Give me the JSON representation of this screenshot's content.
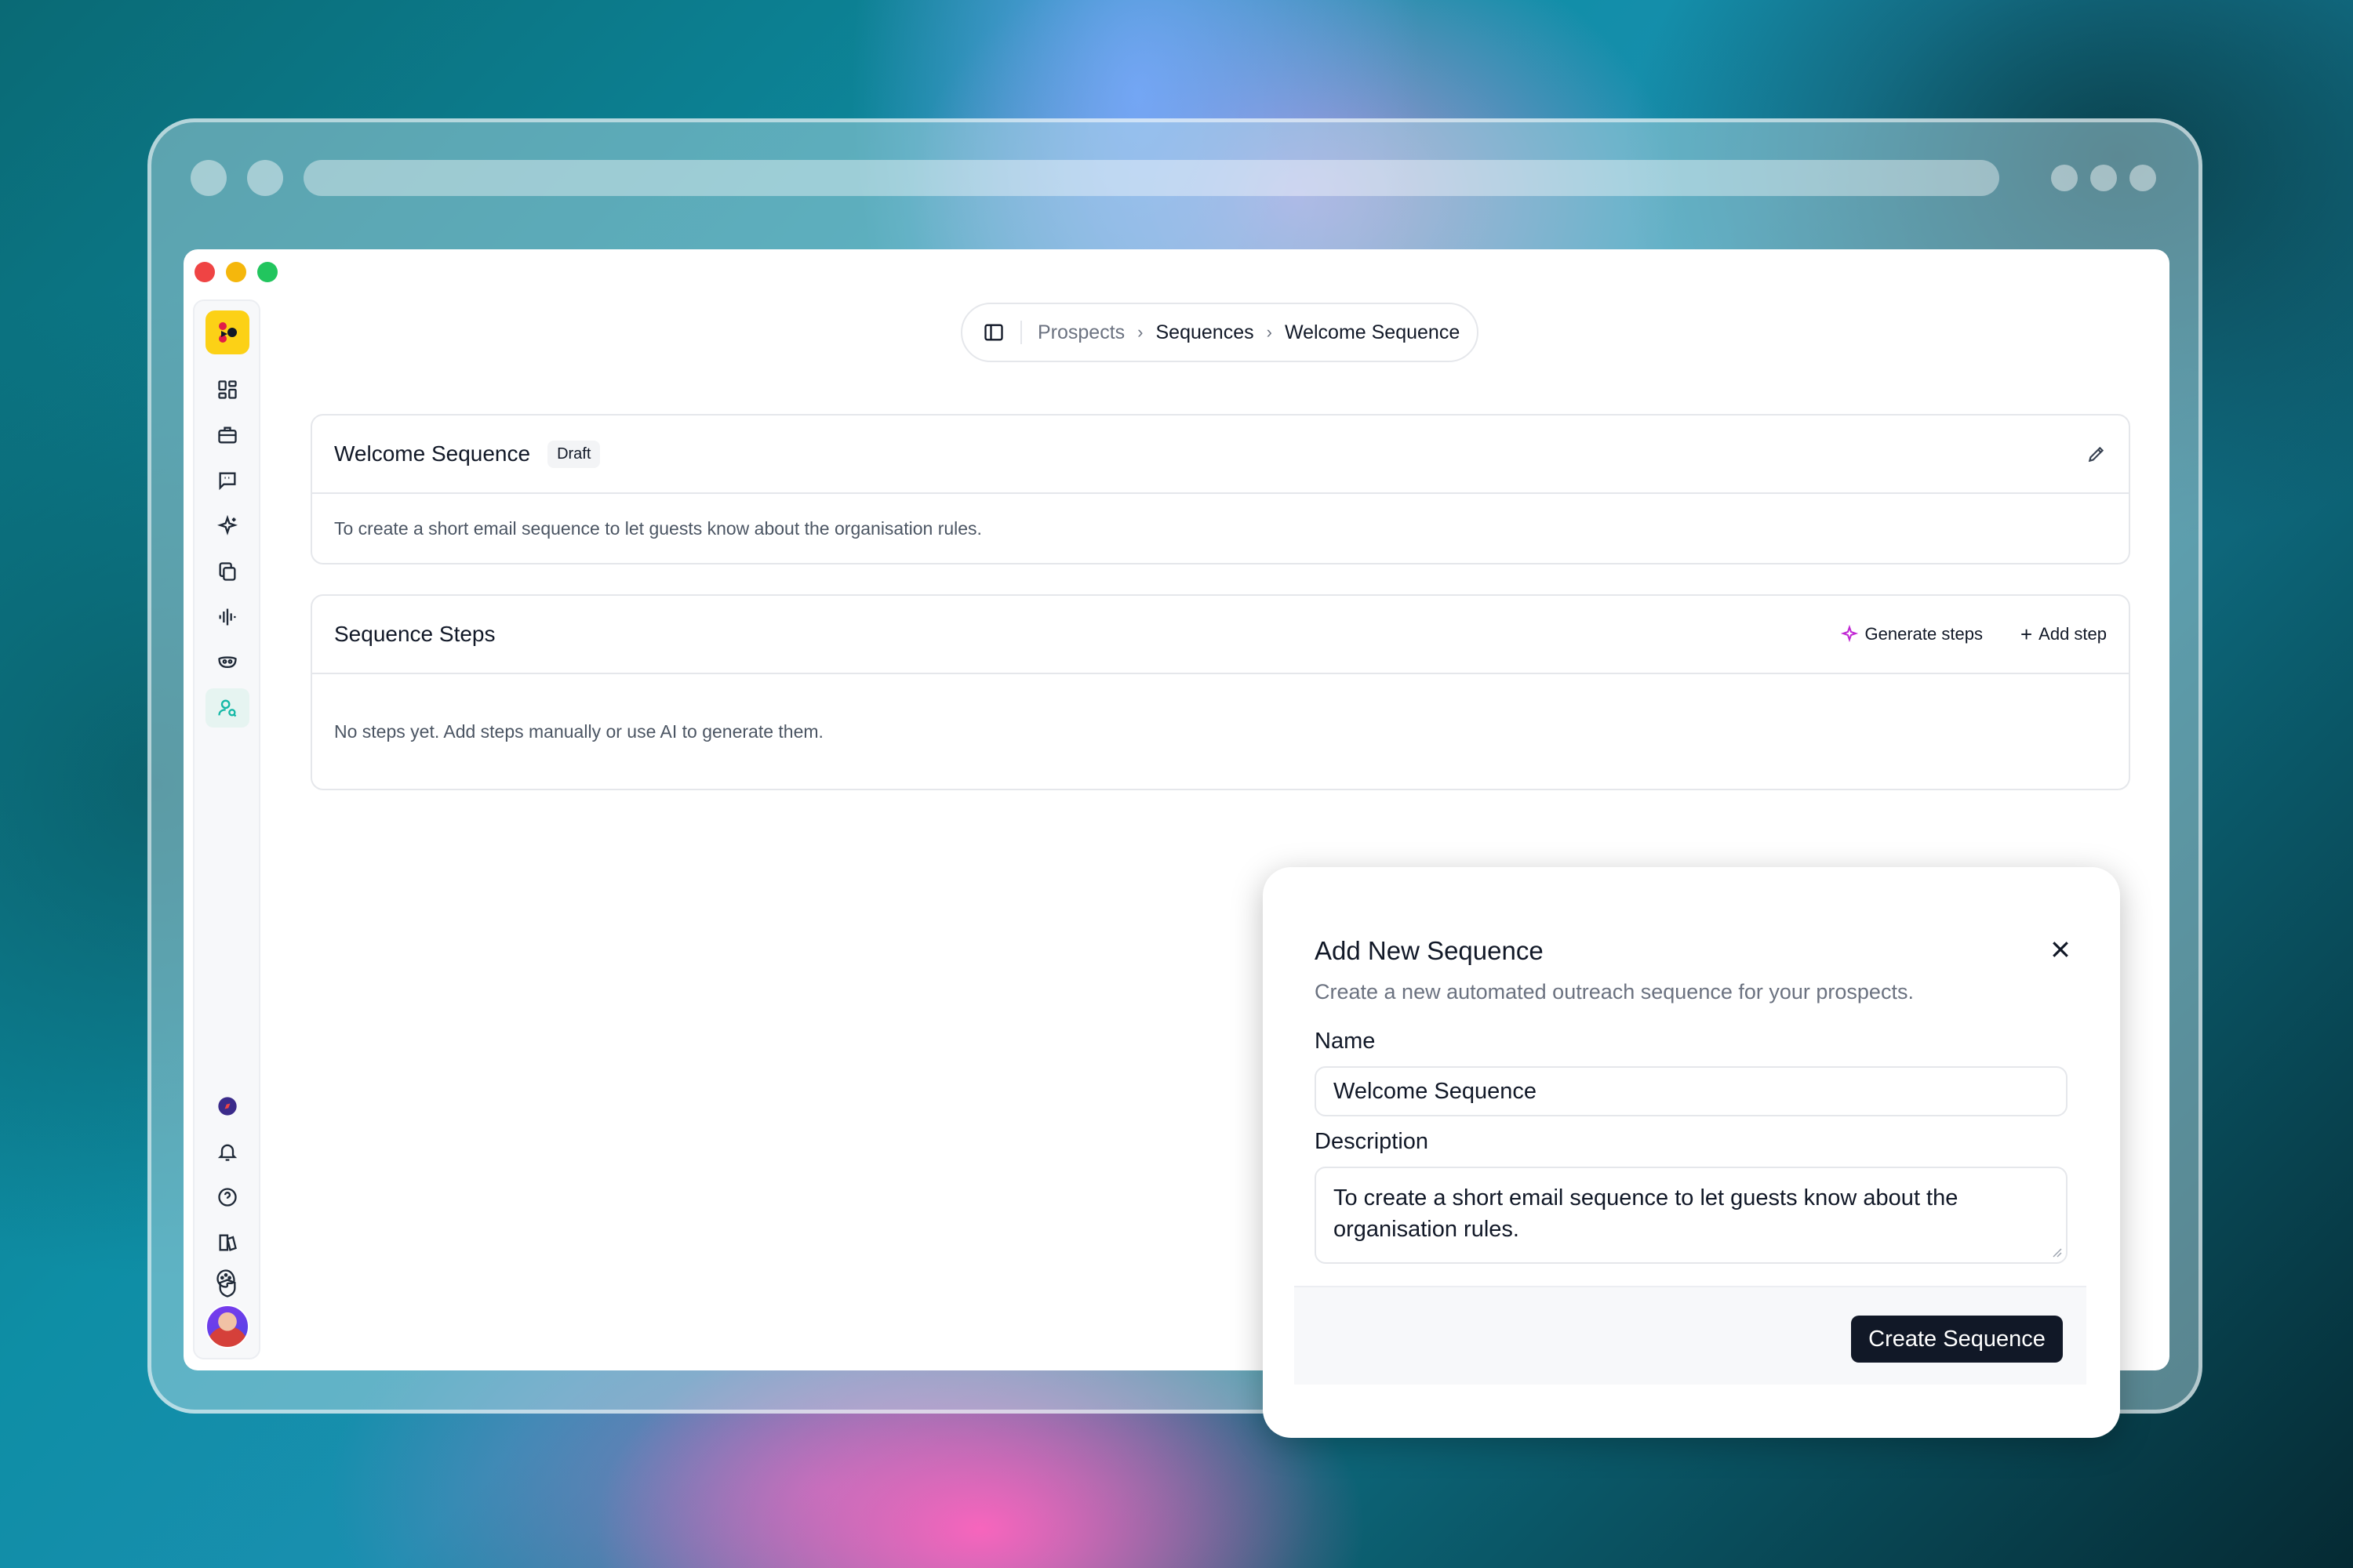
{
  "breadcrumb": {
    "items": [
      "Prospects",
      "Sequences",
      "Welcome Sequence"
    ]
  },
  "sequence_card": {
    "title": "Welcome Sequence",
    "status_badge": "Draft",
    "description": "To create a short email sequence to let guests know about the organisation rules."
  },
  "steps_card": {
    "title": "Sequence Steps",
    "generate_label": "Generate steps",
    "add_label": "Add step",
    "empty_text": "No steps yet. Add steps manually or use AI to generate them."
  },
  "modal": {
    "title": "Add New Sequence",
    "subtitle": "Create a new automated outreach sequence for your prospects.",
    "name_label": "Name",
    "name_value": "Welcome Sequence",
    "description_label": "Description",
    "description_value": "To create a short email sequence to let guests know about the organisation rules.",
    "submit_label": "Create Sequence"
  },
  "sidebar": {
    "top_icons": [
      "dashboard-icon",
      "briefcase-icon",
      "chat-icon",
      "sparkles-icon",
      "copy-icon",
      "waveform-icon",
      "mask-icon",
      "prospects-icon"
    ],
    "bottom_icons": [
      "compass-icon",
      "bell-icon",
      "help-icon",
      "book-icon",
      "shield-icon",
      "palette-icon"
    ],
    "active_item": "prospects-icon"
  },
  "colors": {
    "accent": "#14b8a6",
    "primary_button": "#111827",
    "logo_bg": "#fcd116"
  }
}
